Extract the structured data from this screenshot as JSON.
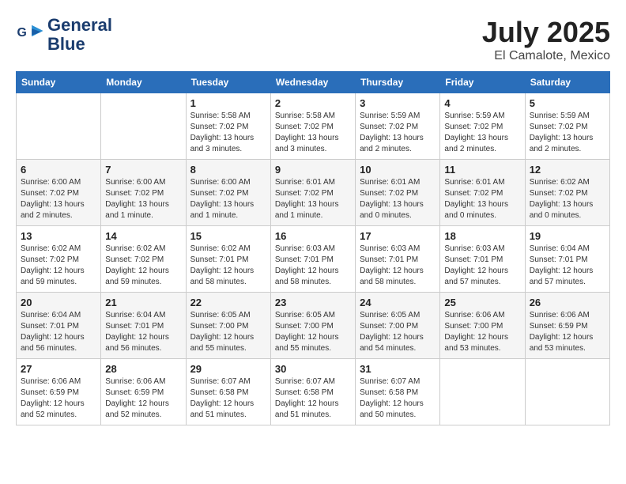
{
  "header": {
    "logo_line1": "General",
    "logo_line2": "Blue",
    "month": "July 2025",
    "location": "El Camalote, Mexico"
  },
  "weekdays": [
    "Sunday",
    "Monday",
    "Tuesday",
    "Wednesday",
    "Thursday",
    "Friday",
    "Saturday"
  ],
  "weeks": [
    [
      {
        "day": "",
        "info": ""
      },
      {
        "day": "",
        "info": ""
      },
      {
        "day": "1",
        "info": "Sunrise: 5:58 AM\nSunset: 7:02 PM\nDaylight: 13 hours and 3 minutes."
      },
      {
        "day": "2",
        "info": "Sunrise: 5:58 AM\nSunset: 7:02 PM\nDaylight: 13 hours and 3 minutes."
      },
      {
        "day": "3",
        "info": "Sunrise: 5:59 AM\nSunset: 7:02 PM\nDaylight: 13 hours and 2 minutes."
      },
      {
        "day": "4",
        "info": "Sunrise: 5:59 AM\nSunset: 7:02 PM\nDaylight: 13 hours and 2 minutes."
      },
      {
        "day": "5",
        "info": "Sunrise: 5:59 AM\nSunset: 7:02 PM\nDaylight: 13 hours and 2 minutes."
      }
    ],
    [
      {
        "day": "6",
        "info": "Sunrise: 6:00 AM\nSunset: 7:02 PM\nDaylight: 13 hours and 2 minutes."
      },
      {
        "day": "7",
        "info": "Sunrise: 6:00 AM\nSunset: 7:02 PM\nDaylight: 13 hours and 1 minute."
      },
      {
        "day": "8",
        "info": "Sunrise: 6:00 AM\nSunset: 7:02 PM\nDaylight: 13 hours and 1 minute."
      },
      {
        "day": "9",
        "info": "Sunrise: 6:01 AM\nSunset: 7:02 PM\nDaylight: 13 hours and 1 minute."
      },
      {
        "day": "10",
        "info": "Sunrise: 6:01 AM\nSunset: 7:02 PM\nDaylight: 13 hours and 0 minutes."
      },
      {
        "day": "11",
        "info": "Sunrise: 6:01 AM\nSunset: 7:02 PM\nDaylight: 13 hours and 0 minutes."
      },
      {
        "day": "12",
        "info": "Sunrise: 6:02 AM\nSunset: 7:02 PM\nDaylight: 13 hours and 0 minutes."
      }
    ],
    [
      {
        "day": "13",
        "info": "Sunrise: 6:02 AM\nSunset: 7:02 PM\nDaylight: 12 hours and 59 minutes."
      },
      {
        "day": "14",
        "info": "Sunrise: 6:02 AM\nSunset: 7:02 PM\nDaylight: 12 hours and 59 minutes."
      },
      {
        "day": "15",
        "info": "Sunrise: 6:02 AM\nSunset: 7:01 PM\nDaylight: 12 hours and 58 minutes."
      },
      {
        "day": "16",
        "info": "Sunrise: 6:03 AM\nSunset: 7:01 PM\nDaylight: 12 hours and 58 minutes."
      },
      {
        "day": "17",
        "info": "Sunrise: 6:03 AM\nSunset: 7:01 PM\nDaylight: 12 hours and 58 minutes."
      },
      {
        "day": "18",
        "info": "Sunrise: 6:03 AM\nSunset: 7:01 PM\nDaylight: 12 hours and 57 minutes."
      },
      {
        "day": "19",
        "info": "Sunrise: 6:04 AM\nSunset: 7:01 PM\nDaylight: 12 hours and 57 minutes."
      }
    ],
    [
      {
        "day": "20",
        "info": "Sunrise: 6:04 AM\nSunset: 7:01 PM\nDaylight: 12 hours and 56 minutes."
      },
      {
        "day": "21",
        "info": "Sunrise: 6:04 AM\nSunset: 7:01 PM\nDaylight: 12 hours and 56 minutes."
      },
      {
        "day": "22",
        "info": "Sunrise: 6:05 AM\nSunset: 7:00 PM\nDaylight: 12 hours and 55 minutes."
      },
      {
        "day": "23",
        "info": "Sunrise: 6:05 AM\nSunset: 7:00 PM\nDaylight: 12 hours and 55 minutes."
      },
      {
        "day": "24",
        "info": "Sunrise: 6:05 AM\nSunset: 7:00 PM\nDaylight: 12 hours and 54 minutes."
      },
      {
        "day": "25",
        "info": "Sunrise: 6:06 AM\nSunset: 7:00 PM\nDaylight: 12 hours and 53 minutes."
      },
      {
        "day": "26",
        "info": "Sunrise: 6:06 AM\nSunset: 6:59 PM\nDaylight: 12 hours and 53 minutes."
      }
    ],
    [
      {
        "day": "27",
        "info": "Sunrise: 6:06 AM\nSunset: 6:59 PM\nDaylight: 12 hours and 52 minutes."
      },
      {
        "day": "28",
        "info": "Sunrise: 6:06 AM\nSunset: 6:59 PM\nDaylight: 12 hours and 52 minutes."
      },
      {
        "day": "29",
        "info": "Sunrise: 6:07 AM\nSunset: 6:58 PM\nDaylight: 12 hours and 51 minutes."
      },
      {
        "day": "30",
        "info": "Sunrise: 6:07 AM\nSunset: 6:58 PM\nDaylight: 12 hours and 51 minutes."
      },
      {
        "day": "31",
        "info": "Sunrise: 6:07 AM\nSunset: 6:58 PM\nDaylight: 12 hours and 50 minutes."
      },
      {
        "day": "",
        "info": ""
      },
      {
        "day": "",
        "info": ""
      }
    ]
  ]
}
